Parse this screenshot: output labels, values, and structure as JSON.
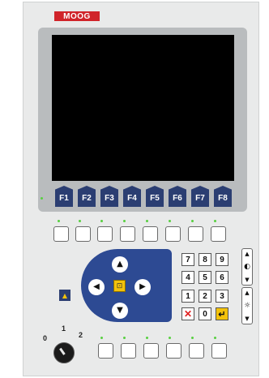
{
  "brand": {
    "logo_text": "MOOG",
    "logo_color": "#d0242a"
  },
  "function_keys": [
    "F1",
    "F2",
    "F3",
    "F4",
    "F5",
    "F6",
    "F7",
    "F8"
  ],
  "keypad": {
    "digits": [
      [
        "7",
        "8",
        "9"
      ],
      [
        "4",
        "5",
        "6"
      ],
      [
        "1",
        "2",
        "3"
      ]
    ],
    "clear_symbol": "✕",
    "zero": "0",
    "enter_symbol": "↵"
  },
  "navigation": {
    "up": "▲",
    "down": "▼",
    "left": "◀",
    "right": "▶",
    "center": "⊡"
  },
  "side_keys": {
    "contrast_up": "▲",
    "contrast_icon": "◐",
    "contrast_down": "▼",
    "brightness_up": "▲",
    "brightness_icon": "☼",
    "brightness_down": "▼"
  },
  "alarm_symbol": "▲",
  "selector_switch": {
    "positions": [
      "0",
      "1",
      "2"
    ]
  },
  "colors": {
    "panel": "#e9eaea",
    "bezel": "#b9bcbe",
    "accent_blue": "#2b3e72",
    "accent_yellow": "#f3c20b",
    "led": "#58d040"
  }
}
